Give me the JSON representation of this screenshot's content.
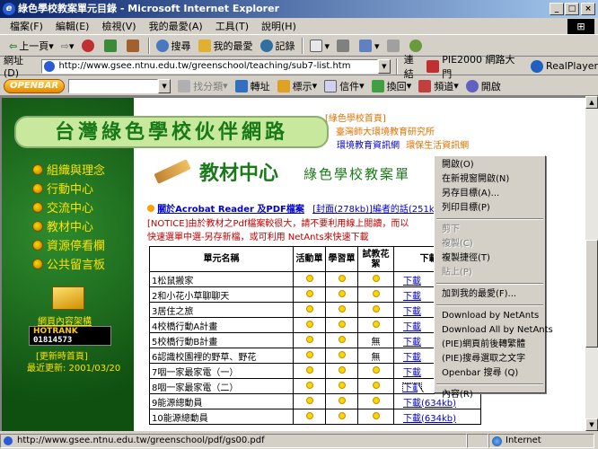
{
  "window": {
    "title": "綠色學校教案單元目錄 - Microsoft Internet Explorer"
  },
  "menu": [
    "檔案(F)",
    "編輯(E)",
    "檢視(V)",
    "我的最愛(A)",
    "工具(T)",
    "說明(H)"
  ],
  "toolbar": {
    "back": "上一頁",
    "search": "搜尋",
    "favorites": "我的最愛",
    "history": "記錄"
  },
  "address": {
    "label": "網址(D)",
    "url": "http://www.gsee.ntnu.edu.tw/greenschool/teaching/sub7-list.htm",
    "go": "連結",
    "link1": "PIE2000 網路大門",
    "link2": "RealPlayer"
  },
  "linkbar": {
    "openbar": "OPENBAR",
    "search": "找分類",
    "convert": "轉址",
    "mark": "標示",
    "mail": "信件",
    "switch": "換回",
    "channel": "頻道",
    "open": "開啟"
  },
  "sidebar": {
    "items": [
      "組織與理念",
      "行動中心",
      "交流中心",
      "教材中心",
      "資源停看欄",
      "公共留言板"
    ],
    "mail_label": "網頁內容架構",
    "hotrank": "HOTRANK",
    "counter": "01814573",
    "update_link": "[更新時首頁]",
    "update_date": "最近更新: 2001/03/20"
  },
  "header": {
    "banner": "台灣綠色學校伙伴網路",
    "home_link": "[綠色學校首頁]",
    "inst_link": "臺灣師大環境教育研究所",
    "env_link": "環境教育資訊網",
    "life_link": "環保生活資訊網"
  },
  "section": {
    "title": "教材中心",
    "subtitle": "綠色學校教案單"
  },
  "notice": {
    "acrobat": "關於Acrobat Reader 及PDF檔案",
    "cover": "[封面(278kb)]",
    "editor": "編者的話(251kb",
    "line1": "[NOTICE]由於教材之Pdf檔案較很大，請不要利用線上閱讀，而以",
    "line2": "快速選單中選-另存新檔，或可利用 NetAnts來快速下載"
  },
  "table": {
    "headers": [
      "單元名稱",
      "活動單",
      "學習單",
      "試教花絮",
      "下載pdf"
    ],
    "rows": [
      {
        "name": "1松鼠搬家",
        "c3": "",
        "dl": "下載"
      },
      {
        "name": "2和小花小草聊聊天",
        "c3": "",
        "dl": "下載"
      },
      {
        "name": "3居住之旅",
        "c3": "",
        "dl": "下載"
      },
      {
        "name": "4校橋行動A計畫",
        "c3": "",
        "dl": "下載"
      },
      {
        "name": "5校橋行動B計畫",
        "c3": "無",
        "dl": "下載"
      },
      {
        "name": "6認識校園裡的野草、野花",
        "c3": "無",
        "dl": "下載"
      },
      {
        "name": "7咽一家最家電（一）",
        "c3": "",
        "dl": "下載"
      },
      {
        "name": "8咽一家最家電（二）",
        "c3": "",
        "dl": "下載"
      },
      {
        "name": "9能源總動員",
        "c3": "",
        "dl": "下載(634kb)"
      },
      {
        "name": "10能源總動員",
        "c3": "",
        "dl": "下載(634kb)"
      }
    ]
  },
  "context_menu": {
    "items": [
      {
        "label": "開啟(O)",
        "disabled": false
      },
      {
        "label": "在新視窗開啟(N)",
        "disabled": false
      },
      {
        "label": "另存目標(A)...",
        "disabled": false
      },
      {
        "label": "列印目標(P)",
        "disabled": false
      },
      {
        "sep": true
      },
      {
        "label": "剪下",
        "disabled": true
      },
      {
        "label": "複製(C)",
        "disabled": true
      },
      {
        "label": "複製捷徑(T)",
        "disabled": false
      },
      {
        "label": "貼上(P)",
        "disabled": true
      },
      {
        "sep": true
      },
      {
        "label": "加到我的最愛(F)...",
        "disabled": false
      },
      {
        "sep": true
      },
      {
        "label": "Download by NetAnts",
        "disabled": false
      },
      {
        "label": "Download All by NetAnts",
        "disabled": false
      },
      {
        "label": "(PIE)網頁前後轉繁體",
        "disabled": false
      },
      {
        "label": "(PIE)搜尋選取之文字",
        "disabled": false
      },
      {
        "label": "Openbar 搜尋 (Q)",
        "disabled": false
      },
      {
        "sep": true
      },
      {
        "label": "內容(R)",
        "disabled": false
      }
    ]
  },
  "status": {
    "url": "http://www.gsee.ntnu.edu.tw/greenschool/pdf/gs00.pdf",
    "zone": "Internet"
  }
}
